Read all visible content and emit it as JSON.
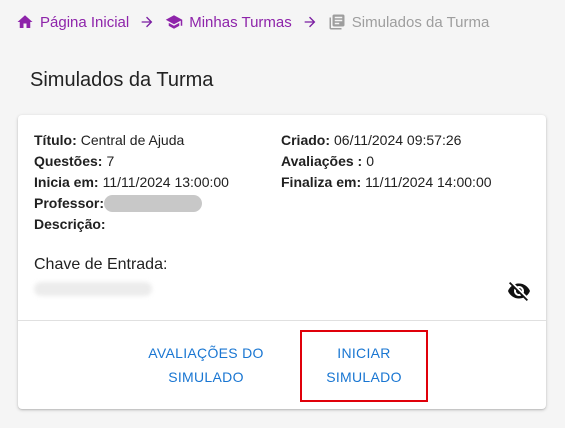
{
  "breadcrumb": {
    "items": [
      {
        "label": "Página Inicial",
        "icon": "home-icon"
      },
      {
        "label": "Minhas Turmas",
        "icon": "school-icon"
      },
      {
        "label": "Simulados da Turma",
        "icon": "newspaper-icon"
      }
    ],
    "separator_icon": "arrow-right-icon",
    "link_color": "#8e24aa",
    "current_color": "#9e9e9e"
  },
  "page": {
    "title": "Simulados da Turma"
  },
  "card": {
    "left": [
      {
        "label": "Título:",
        "value": "Central de Ajuda"
      },
      {
        "label": "Questões:",
        "value": "7"
      },
      {
        "label": "Inicia em:",
        "value": "11/11/2024 13:00:00"
      },
      {
        "label": "Professor:",
        "value": ""
      },
      {
        "label": "Descrição:",
        "value": ""
      }
    ],
    "right": [
      {
        "label": "Criado:",
        "value": "06/11/2024 09:57:26"
      },
      {
        "label": "Avaliações :",
        "value": "0"
      },
      {
        "label": "Finaliza em:",
        "value": "11/11/2024 14:00:00"
      }
    ],
    "key_label": "Chave de Entrada:",
    "visibility_icon": "eye-off-icon",
    "actions": {
      "evaluations_line1": "AVALIAÇÕES DO",
      "evaluations_line2": "SIMULADO",
      "start_line1": "INICIAR",
      "start_line2": "SIMULADO"
    },
    "action_color": "#1976d2",
    "highlight_color": "#e0000a"
  }
}
